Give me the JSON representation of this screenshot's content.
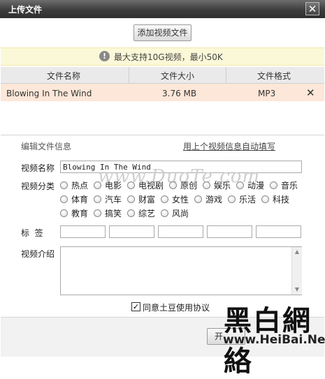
{
  "dialog": {
    "title": "上传文件",
    "close_symbol": "✕"
  },
  "toolbar": {
    "add_video_label": "添加视频文件"
  },
  "notice": {
    "text": "最大支持10G视频，最小50K",
    "icon": "info-icon"
  },
  "table": {
    "headers": [
      "文件名称",
      "文件大小",
      "文件格式"
    ],
    "rows": [
      {
        "name": "Blowing In The Wind",
        "size": "3.76 MB",
        "format": "MP3",
        "delete_symbol": "✕"
      }
    ]
  },
  "edit": {
    "section_label": "编辑文件信息",
    "autofill_link": "用上个视频信息自动填写",
    "name_label": "视频名称",
    "name_value": "Blowing In The Wind",
    "category_label": "视频分类",
    "categories": [
      "热点",
      "电影",
      "电视剧",
      "原创",
      "娱乐",
      "动漫",
      "音乐",
      "体育",
      "汽车",
      "财富",
      "女性",
      "游戏",
      "乐活",
      "科技",
      "教育",
      "搞笑",
      "综艺",
      "风尚"
    ],
    "tags_label": "标  签",
    "intro_label": "视频介绍",
    "agree_label": "同意土豆使用协议",
    "agree_checked": true
  },
  "footer": {
    "start_label": "开"
  },
  "watermark": {
    "big": "黑白網絡",
    "url": "www.HeiBai.Net",
    "faint": "www.DuoTe.com"
  }
}
